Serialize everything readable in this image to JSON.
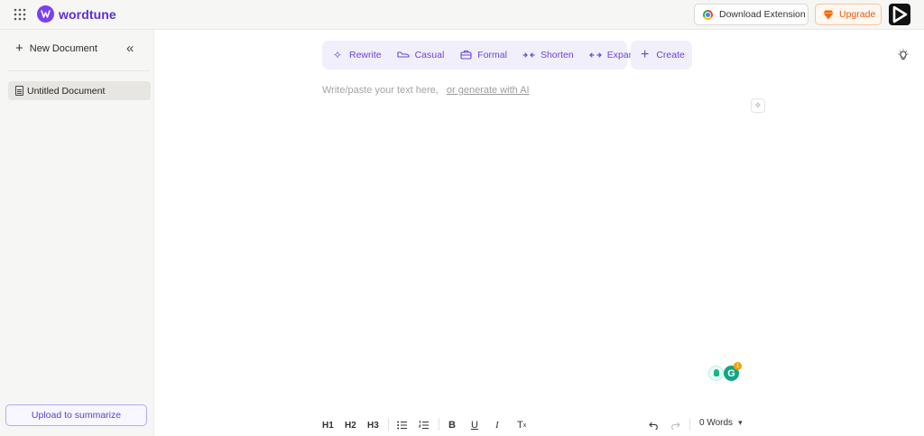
{
  "app": {
    "logo_text": "wordtune",
    "brand_color": "#7b3ff2",
    "accent_color": "#e8590c"
  },
  "header": {
    "apps_icon": "grid-icon",
    "download_extension_label": "Download Extension",
    "upgrade_label": "Upgrade",
    "extension_icon": "chrome-icon",
    "upgrade_icon": "gem-icon",
    "player_icon": "play-icon"
  },
  "sidebar": {
    "new_document_label": "New Document",
    "collapse_icon": "double-chevron-left-icon",
    "documents": [
      {
        "label": "Untitled Document",
        "selected": true
      }
    ],
    "upload_label": "Upload to summarize"
  },
  "toolbar": {
    "tools": [
      {
        "label": "Rewrite",
        "icon": "sparkles-icon"
      },
      {
        "label": "Casual",
        "icon": "sneaker-icon"
      },
      {
        "label": "Formal",
        "icon": "briefcase-icon"
      },
      {
        "label": "Shorten",
        "icon": "arrows-in-icon"
      },
      {
        "label": "Expand",
        "icon": "arrows-out-icon"
      }
    ],
    "create_label": "Create",
    "lightbulb_icon": "lightbulb-icon"
  },
  "editor": {
    "placeholder": "Write/paste your text here,",
    "generate_link": "or generate with AI"
  },
  "assistant": {
    "grammarly_badge_count": "1"
  },
  "format_bar": {
    "headings": [
      "H1",
      "H2",
      "H3"
    ],
    "word_count_label": "0 Words"
  }
}
